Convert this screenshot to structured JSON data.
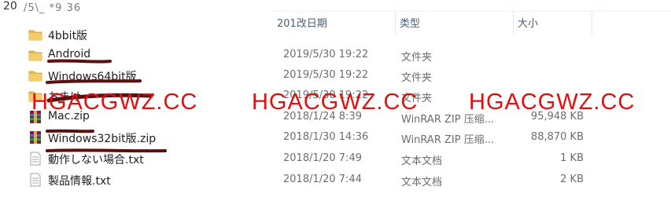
{
  "breadcrumb": {
    "num": "20",
    "text": "/5\\_ *9 36"
  },
  "columns": {
    "date": "201改日期",
    "type": "类型",
    "size": "大小"
  },
  "files": [
    {
      "name": "4bbit版",
      "date": "",
      "type": "",
      "size": "",
      "icon": "folder-icon"
    },
    {
      "name": "Android",
      "date": "2019/5/30 19:22",
      "type": "文件夹",
      "size": "",
      "icon": "folder-icon"
    },
    {
      "name": "Windows64bit版",
      "date": "2019/5/30 19:22",
      "type": "文件夹",
      "size": "",
      "icon": "folder-icon"
    },
    {
      "name": "おまけ",
      "date": "2019/5/30 19:22",
      "type": "文件夹",
      "size": "",
      "icon": "folder-icon"
    },
    {
      "name": "Mac.zip",
      "date": "2018/1/24 8:39",
      "type": "WinRAR ZIP 压缩...",
      "size": "95,948 KB",
      "icon": "winrar-zip-icon"
    },
    {
      "name": "Windows32bit版.zip",
      "date": "2018/1/30 14:36",
      "type": "WinRAR ZIP 压缩...",
      "size": "88,870 KB",
      "icon": "winrar-zip-icon"
    },
    {
      "name": "動作しない場合.txt",
      "date": "2018/1/20 7:49",
      "type": "文本文档",
      "size": "1 KB",
      "icon": "text-file-icon"
    },
    {
      "name": "製品情報.txt",
      "date": "2018/1/20 7:44",
      "type": "文本文档",
      "size": "2 KB",
      "icon": "text-file-icon"
    }
  ],
  "watermark": {
    "text": "HGACGWZ.CC",
    "color": "#e01010"
  },
  "colors": {
    "folder": "#e8b84a",
    "header_text": "#4c607a",
    "row_text": "#6d6d6d"
  }
}
